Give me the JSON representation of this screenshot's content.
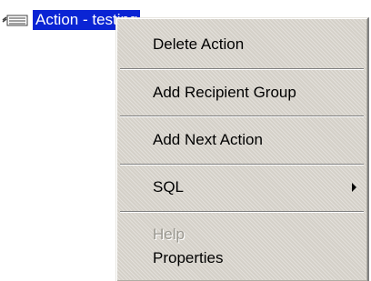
{
  "tree": {
    "icon": "action-node-icon",
    "selected_label": "Action - testing"
  },
  "context_menu": {
    "items": [
      {
        "label": "Delete Action",
        "enabled": true
      },
      {
        "label": "Add Recipient Group",
        "enabled": true
      },
      {
        "label": "Add Next Action",
        "enabled": true
      },
      {
        "label": "SQL",
        "enabled": true,
        "submenu": true
      },
      {
        "label": "Help",
        "enabled": false
      },
      {
        "label": "Properties",
        "enabled": true
      }
    ]
  },
  "colors": {
    "selection": "#0a24d4",
    "menu_background": "#d4d0c8",
    "disabled_text": "#9a9890"
  }
}
